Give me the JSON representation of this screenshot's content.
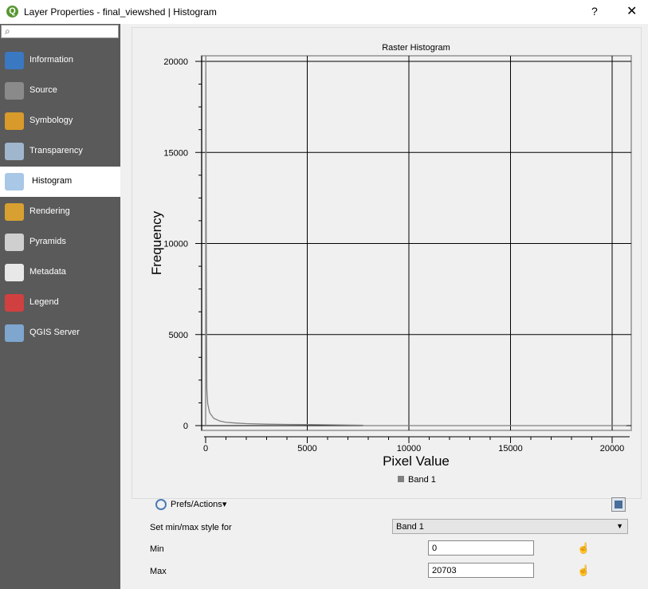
{
  "window": {
    "title": "Layer Properties - final_viewshed | Histogram",
    "help": "?",
    "close": "✕"
  },
  "sidebar": {
    "search_placeholder": "",
    "items": [
      {
        "label": "Information",
        "color": "#3b78c2"
      },
      {
        "label": "Source",
        "color": "#8a8a8a"
      },
      {
        "label": "Symbology",
        "color": "#d89a2a"
      },
      {
        "label": "Transparency",
        "color": "#9fb6cc"
      },
      {
        "label": "Histogram",
        "color": "#a9c7e6"
      },
      {
        "label": "Rendering",
        "color": "#d8a030"
      },
      {
        "label": "Pyramids",
        "color": "#cfcfcf"
      },
      {
        "label": "Metadata",
        "color": "#e8e8e8"
      },
      {
        "label": "Legend",
        "color": "#d04040"
      },
      {
        "label": "QGIS Server",
        "color": "#7ea6cf"
      }
    ],
    "selected": "Histogram"
  },
  "chart_data": {
    "type": "line",
    "title": "Raster Histogram",
    "xlabel": "Pixel Value",
    "ylabel": "Frequency",
    "xlim": [
      -200,
      20900
    ],
    "ylim": [
      0,
      20000
    ],
    "xticks": [
      0,
      5000,
      10000,
      15000,
      20000
    ],
    "yticks": [
      0,
      5000,
      10000,
      15000,
      20000
    ],
    "xtick_labels": [
      "0",
      "5000",
      "10000",
      "15000",
      "20000"
    ],
    "ytick_labels": [
      "0",
      "5000",
      "10000",
      "15000",
      "20000"
    ],
    "grid": true,
    "legend": [
      "Band 1"
    ],
    "legend_placement": "bottom",
    "series": [
      {
        "name": "Band 1",
        "color": "#808080",
        "x": [
          0,
          10,
          30,
          60,
          100,
          200,
          400,
          700,
          1000,
          1500,
          2000,
          3000,
          4000,
          5000,
          6000,
          7000,
          7700,
          7800,
          10000,
          15000,
          20703
        ],
        "y": [
          0,
          20500,
          9000,
          2000,
          1200,
          700,
          400,
          250,
          180,
          140,
          110,
          80,
          65,
          55,
          45,
          30,
          20,
          0,
          0,
          0,
          0
        ]
      }
    ]
  },
  "controls": {
    "prefs_label": "Prefs/Actions",
    "minmax_label": "Set min/max style for",
    "band_select": "Band 1",
    "min_label": "Min",
    "min_value": "0",
    "max_label": "Max",
    "max_value": "20703"
  }
}
